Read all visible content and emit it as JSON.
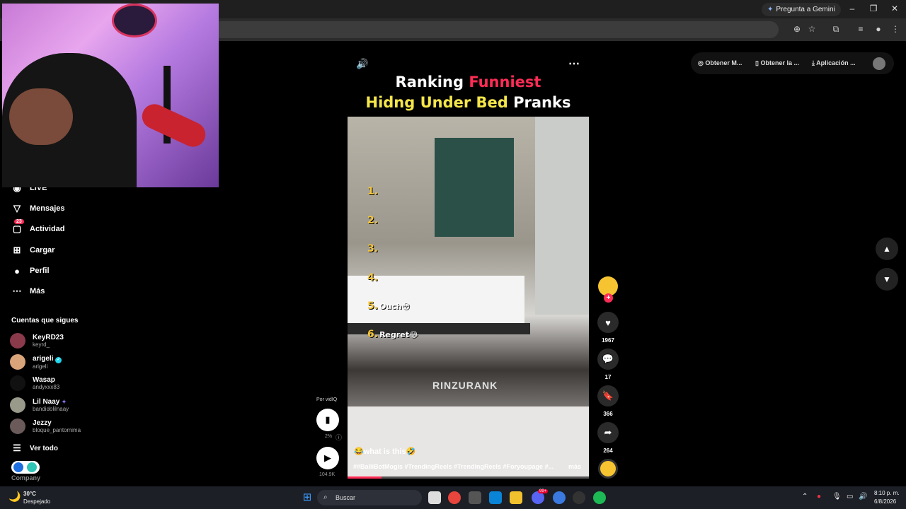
{
  "browser": {
    "gemini_label": "Pregunta a Gemini",
    "window_controls": [
      "–",
      "❐",
      "✕"
    ]
  },
  "sidebar": {
    "items": [
      {
        "label": "LIVE",
        "icon": "live-icon"
      },
      {
        "label": "Mensajes",
        "icon": "send-icon"
      },
      {
        "label": "Actividad",
        "icon": "activity-icon",
        "badge": "23"
      },
      {
        "label": "Cargar",
        "icon": "upload-icon"
      },
      {
        "label": "Perfil",
        "icon": "profile-avatar"
      },
      {
        "label": "Más",
        "icon": "more-icon"
      }
    ],
    "following_title": "Cuentas que sigues",
    "accounts": [
      {
        "name": "KeyRD23",
        "handle": "keyrd_"
      },
      {
        "name": "arigeli",
        "handle": "arigeli",
        "verified": true
      },
      {
        "name": "Wasap",
        "handle": "andyxxx83"
      },
      {
        "name": "Lil Naay",
        "handle": "bandidolilnaay"
      },
      {
        "name": "Jezzy",
        "handle": "bloque_pantomima"
      }
    ],
    "see_all": "Ver todo",
    "company": "Company"
  },
  "video": {
    "title_line1_a": "Ranking",
    "title_line1_b": "Funniest",
    "title_line2_a": "Hidng Under Bed",
    "title_line2_b": "Pranks",
    "ranks": [
      {
        "n": "1.",
        "label": ""
      },
      {
        "n": "2.",
        "label": ""
      },
      {
        "n": "3.",
        "label": ""
      },
      {
        "n": "4.",
        "label": ""
      },
      {
        "n": "5.",
        "label": "Ouch😳"
      },
      {
        "n": "6.",
        "label": "Regret😂"
      }
    ],
    "watermark": "RINZURANK",
    "caption": "😂what is this🤣",
    "hashtags": "##BalliBotMogis #TrendingReels #TrendingReels #Foryoupage #...",
    "more_label": "más",
    "progress": 0.14
  },
  "actions": {
    "likes": "1967",
    "comments": "17",
    "saves": "366",
    "shares": "264"
  },
  "vidiq": {
    "label": "Por vidIQ",
    "percent": "2%",
    "views": "104.9K"
  },
  "top_options": {
    "get_coins": "Obtener M...",
    "get_app": "Obtener la ...",
    "desktop_app": "Aplicación ..."
  },
  "taskbar": {
    "temperature": "30°C",
    "weather": "Despejado",
    "search_placeholder": "Buscar",
    "time": "8:10 p. m.",
    "date": "6/8/2026",
    "notif_badge": "99+"
  }
}
